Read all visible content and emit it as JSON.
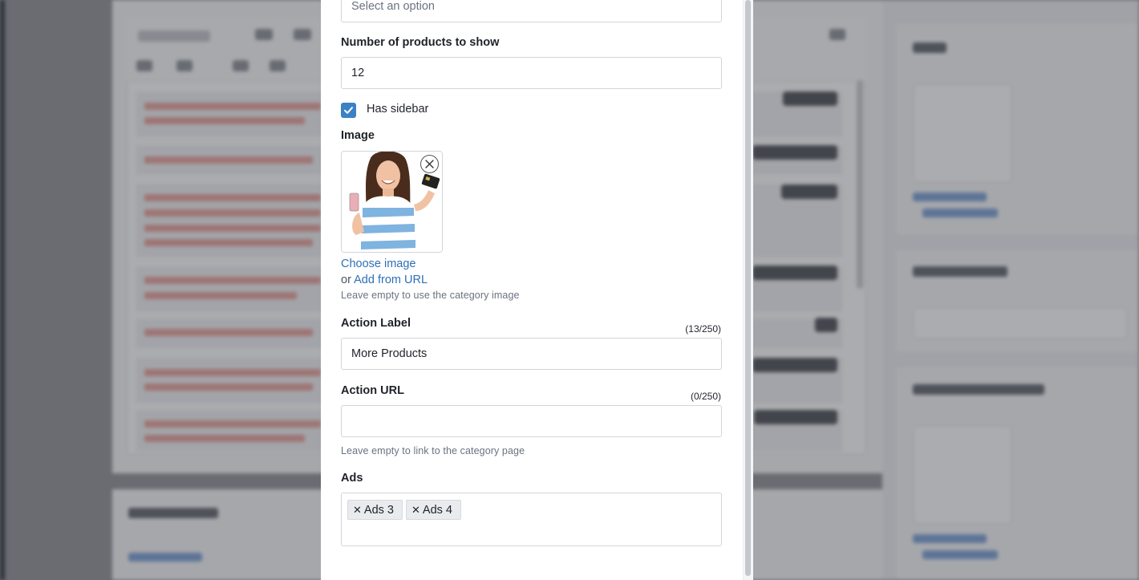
{
  "form": {
    "category_select": {
      "placeholder": "Select an option"
    },
    "products_count": {
      "label": "Number of products to show",
      "value": "12"
    },
    "has_sidebar": {
      "label": "Has sidebar",
      "checked": true
    },
    "image": {
      "label": "Image",
      "choose_label": "Choose image",
      "or_text": "or",
      "add_url_label": "Add from URL",
      "help": "Leave empty to use the category image"
    },
    "action_label": {
      "label": "Action Label",
      "counter": "(13/250)",
      "value": "More Products"
    },
    "action_url": {
      "label": "Action URL",
      "counter": "(0/250)",
      "value": "",
      "help": "Leave empty to link to the category page"
    },
    "ads": {
      "label": "Ads",
      "tags": [
        "Ads 3",
        "Ads 4"
      ]
    }
  },
  "colors": {
    "accent": "#3b82c4",
    "link": "#2f6fb5",
    "border": "#d1d5db"
  },
  "icons": {
    "checkbox": "check-icon",
    "remove_image": "close-icon",
    "tag_remove": "x-icon"
  }
}
